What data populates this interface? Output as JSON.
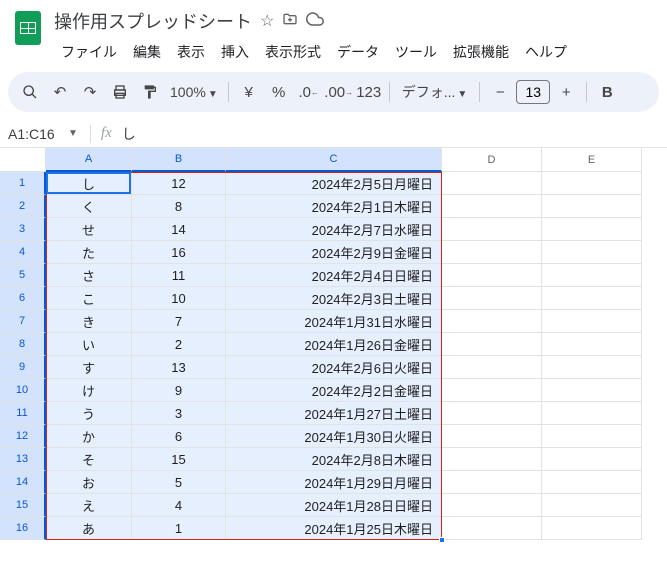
{
  "doc": {
    "title": "操作用スプレッドシート"
  },
  "menu": {
    "file": "ファイル",
    "edit": "編集",
    "view": "表示",
    "insert": "挿入",
    "format": "表示形式",
    "data": "データ",
    "tools": "ツール",
    "extensions": "拡張機能",
    "help": "ヘルプ"
  },
  "toolbar": {
    "zoom": "100%",
    "font": "デフォ...",
    "font_size": "13"
  },
  "namebox": {
    "ref": "A1:C16",
    "formula": "し"
  },
  "cols": [
    "A",
    "B",
    "C",
    "D",
    "E"
  ],
  "rows": [
    {
      "n": "1",
      "a": "し",
      "b": "12",
      "c": "2024年2月5日月曜日"
    },
    {
      "n": "2",
      "a": "く",
      "b": "8",
      "c": "2024年2月1日木曜日"
    },
    {
      "n": "3",
      "a": "せ",
      "b": "14",
      "c": "2024年2月7日水曜日"
    },
    {
      "n": "4",
      "a": "た",
      "b": "16",
      "c": "2024年2月9日金曜日"
    },
    {
      "n": "5",
      "a": "さ",
      "b": "11",
      "c": "2024年2月4日日曜日"
    },
    {
      "n": "6",
      "a": "こ",
      "b": "10",
      "c": "2024年2月3日土曜日"
    },
    {
      "n": "7",
      "a": "き",
      "b": "7",
      "c": "2024年1月31日水曜日"
    },
    {
      "n": "8",
      "a": "い",
      "b": "2",
      "c": "2024年1月26日金曜日"
    },
    {
      "n": "9",
      "a": "す",
      "b": "13",
      "c": "2024年2月6日火曜日"
    },
    {
      "n": "10",
      "a": "け",
      "b": "9",
      "c": "2024年2月2日金曜日"
    },
    {
      "n": "11",
      "a": "う",
      "b": "3",
      "c": "2024年1月27日土曜日"
    },
    {
      "n": "12",
      "a": "か",
      "b": "6",
      "c": "2024年1月30日火曜日"
    },
    {
      "n": "13",
      "a": "そ",
      "b": "15",
      "c": "2024年2月8日木曜日"
    },
    {
      "n": "14",
      "a": "お",
      "b": "5",
      "c": "2024年1月29日月曜日"
    },
    {
      "n": "15",
      "a": "え",
      "b": "4",
      "c": "2024年1月28日日曜日"
    },
    {
      "n": "16",
      "a": "あ",
      "b": "1",
      "c": "2024年1月25日木曜日"
    }
  ]
}
